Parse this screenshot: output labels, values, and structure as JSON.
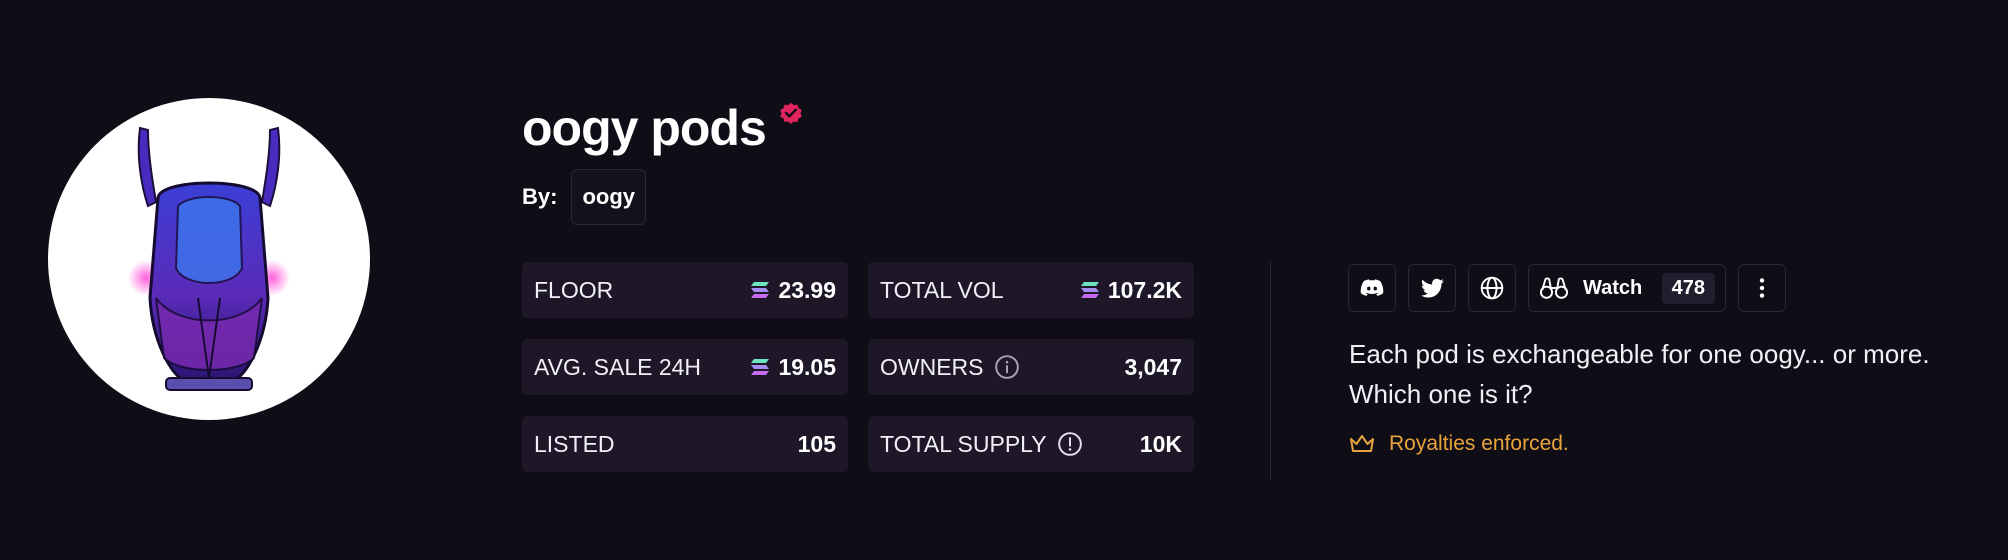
{
  "collection": {
    "title": "oogy pods",
    "by_label": "By:",
    "creator": "oogy"
  },
  "stats": [
    {
      "label": "FLOOR",
      "value": "23.99",
      "icon": "solana-icon"
    },
    {
      "label": "TOTAL VOL",
      "value": "107.2K",
      "icon": "solana-icon"
    },
    {
      "label": "AVG. SALE 24H",
      "value": "19.05",
      "icon": "solana-icon"
    },
    {
      "label": "OWNERS",
      "value": "3,047",
      "icon": "info-icon"
    },
    {
      "label": "LISTED",
      "value": "105"
    },
    {
      "label": "TOTAL SUPPLY",
      "value": "10K",
      "icon": "alert-icon"
    }
  ],
  "actions": {
    "discord_icon": "discord-icon",
    "twitter_icon": "twitter-icon",
    "website_icon": "globe-icon",
    "watch_label": "Watch",
    "watch_count": "478",
    "more_icon": "more-vertical-icon"
  },
  "description": "Each pod is exchangeable for one oogy... or more. Which one is it?",
  "royalties": "Royalties enforced.",
  "colors": {
    "background": "#0f0d16",
    "stat_bg": "#1d1728",
    "verified": "#e0245e",
    "royalties": "#e8a33d"
  }
}
